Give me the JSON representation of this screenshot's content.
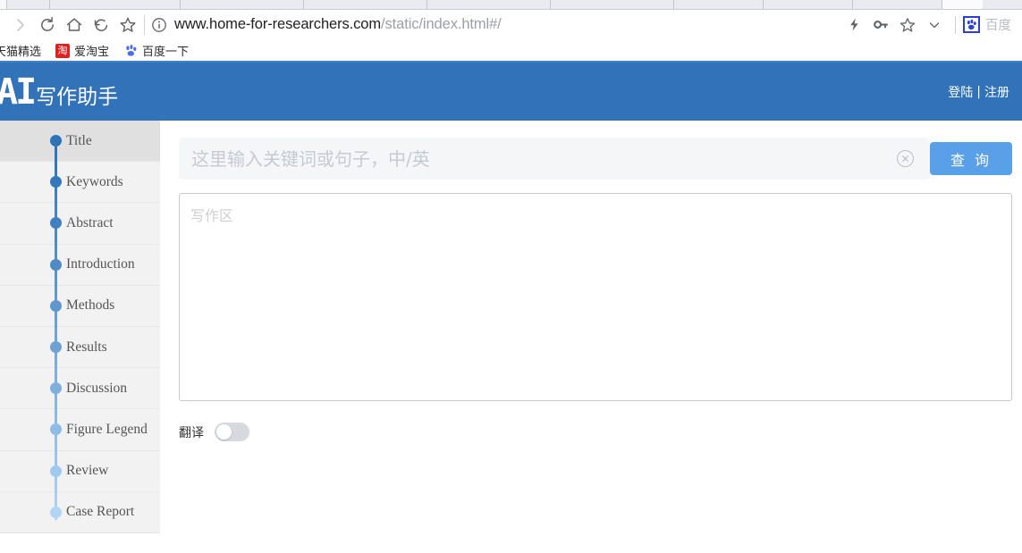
{
  "browser": {
    "nav_icons": [
      {
        "name": "forward-icon",
        "label": "Forward"
      },
      {
        "name": "reload-icon",
        "label": "Reload"
      },
      {
        "name": "home-icon",
        "label": "Home"
      },
      {
        "name": "back-arrow-icon",
        "label": "Back"
      },
      {
        "name": "bookmark-star-icon",
        "label": "Bookmark"
      }
    ],
    "url": {
      "domain": "www.home-for-researchers.com",
      "path": "/static/index.html#/"
    },
    "toolbar_right": {
      "lightning_icon": "lightning-icon",
      "key_icon": "key-icon",
      "star_icon": "star-icon",
      "chevron_icon": "chevron-down-icon",
      "extension_label": "百度"
    },
    "bookmarks": [
      {
        "label": "天猫精选",
        "icon": ""
      },
      {
        "label": "爱淘宝",
        "icon": "淘"
      },
      {
        "label": "百度一下",
        "icon": "paw"
      }
    ]
  },
  "header": {
    "logo_ai": "AI",
    "logo_text": "写作助手",
    "login_label": "登陆",
    "separator": "|",
    "register_label": "注册",
    "bg_color": "#3172b9"
  },
  "sidebar": {
    "items": [
      {
        "label": "Title",
        "dot_color": "#2f72b8",
        "active": true
      },
      {
        "label": "Keywords",
        "dot_color": "#3577bb",
        "active": false
      },
      {
        "label": "Abstract",
        "dot_color": "#4180c0",
        "active": false
      },
      {
        "label": "Introduction",
        "dot_color": "#4f8bc7",
        "active": false
      },
      {
        "label": "Methods",
        "dot_color": "#5f97cd",
        "active": false
      },
      {
        "label": "Results",
        "dot_color": "#6ea2d4",
        "active": false
      },
      {
        "label": "Discussion",
        "dot_color": "#7fb0dd",
        "active": false
      },
      {
        "label": "Figure Legend",
        "dot_color": "#8fbce6",
        "active": false
      },
      {
        "label": "Review",
        "dot_color": "#a1c9ef",
        "active": false
      },
      {
        "label": "Case Report",
        "dot_color": "#b2d4f5",
        "active": false
      }
    ]
  },
  "main": {
    "search": {
      "placeholder": "这里输入关键词或句子，中/英",
      "value": "",
      "clear_icon": "clear-circle-icon",
      "button_label": "查 询"
    },
    "editor": {
      "placeholder": "写作区",
      "value": ""
    },
    "translate": {
      "label": "翻译",
      "enabled": false
    }
  },
  "colors": {
    "accent": "#3172b9",
    "button": "#5aa0e8",
    "sidebar_bg": "#f2f2f2",
    "active_item_bg": "#e0e0e0"
  }
}
